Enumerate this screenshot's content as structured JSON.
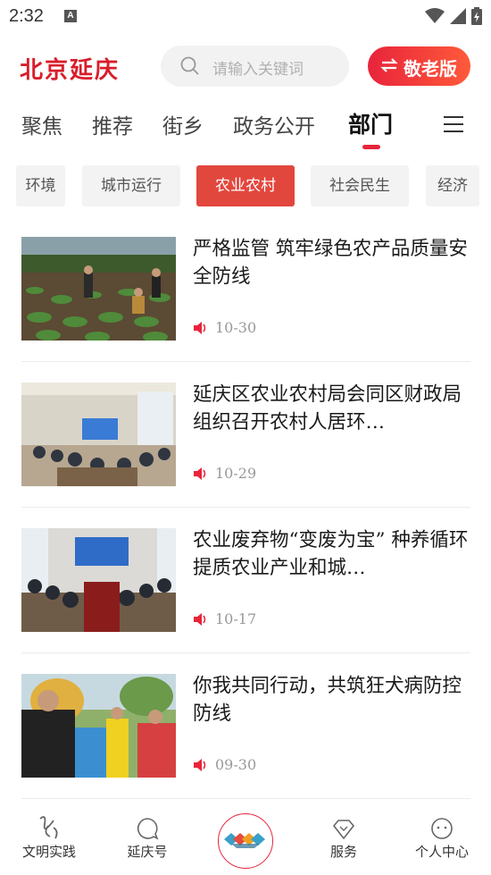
{
  "status_bar": {
    "time": "2:32",
    "a_label": "A"
  },
  "header": {
    "logo": "北京延庆",
    "search_placeholder": "请输入关键词",
    "elder_mode_label": "敬老版"
  },
  "tabs": [
    {
      "label": "聚焦",
      "active": false
    },
    {
      "label": "推荐",
      "active": false
    },
    {
      "label": "街乡",
      "active": false
    },
    {
      "label": "政务公开",
      "active": false
    },
    {
      "label": "部门",
      "active": true
    }
  ],
  "chips": [
    {
      "label": "环境",
      "active": false
    },
    {
      "label": "城市运行",
      "active": false
    },
    {
      "label": "农业农村",
      "active": true
    },
    {
      "label": "社会民生",
      "active": false
    },
    {
      "label": "经济",
      "active": false
    }
  ],
  "news": [
    {
      "title": "严格监管  筑牢绿色农产品质量安全防线",
      "date": "10-30",
      "image": "farm-field-photo"
    },
    {
      "title": "延庆区农业农村局会同区财政局组织召开农村人居环…",
      "date": "10-29",
      "image": "meeting-room-photo"
    },
    {
      "title": "农业废弃物“变废为宝”  种养循环提质农业产业和城…",
      "date": "10-17",
      "image": "conference-photo"
    },
    {
      "title": "你我共同行动，共筑狂犬病防控防线",
      "date": "09-30",
      "image": "outdoor-campaign-photo"
    }
  ],
  "bottom_nav": [
    {
      "label": "文明实践",
      "icon": "calligraphy-icon"
    },
    {
      "label": "延庆号",
      "icon": "chat-bubble-icon"
    },
    {
      "label": "",
      "icon": "home-logo-icon"
    },
    {
      "label": "服务",
      "icon": "diamond-icon"
    },
    {
      "label": "个人中心",
      "icon": "face-icon"
    }
  ],
  "colors": {
    "accent": "#e8243b",
    "chip_active": "#e2473e",
    "muted": "#999999"
  }
}
